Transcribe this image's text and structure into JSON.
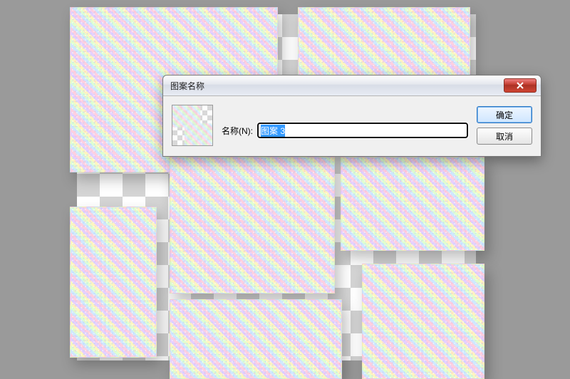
{
  "dialog": {
    "title": "图案名称",
    "name_label": "名称(N):",
    "name_value": "图案 3",
    "ok_label": "确定",
    "cancel_label": "取消"
  }
}
